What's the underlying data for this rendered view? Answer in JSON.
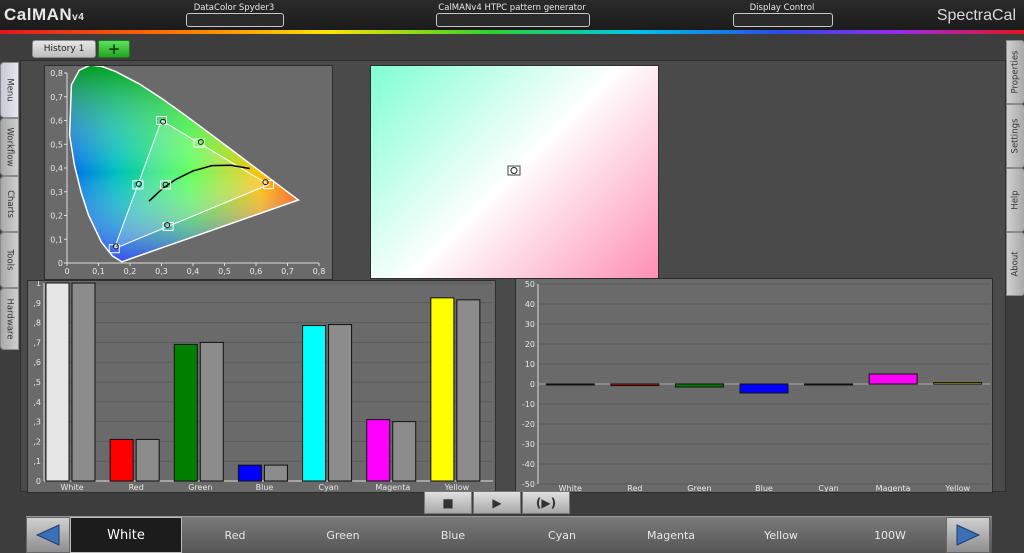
{
  "app": {
    "logo": "CalMAN",
    "logo_version": "v4",
    "brand": "SpectraCal"
  },
  "devices": {
    "meter": "DataColor Spyder3",
    "source": "CalMANv4 HTPC pattern generator",
    "display": "Display Control"
  },
  "left_tabs": [
    "Menu",
    "Workflow",
    "Charts",
    "Tools",
    "Hardware"
  ],
  "right_tabs": [
    "Properties",
    "Settings",
    "Help",
    "About"
  ],
  "history": {
    "tab_label": "History 1",
    "add_label": "+"
  },
  "patches": {
    "items": [
      "White",
      "Red",
      "Green",
      "Blue",
      "Cyan",
      "Magenta",
      "Yellow",
      "100W"
    ],
    "selected": "White"
  },
  "transport": {
    "stop": "■",
    "play": "▶",
    "play_all": "(▶)"
  },
  "colors": {
    "white": "#e6e6e6",
    "red": "#ff0000",
    "green": "#008000",
    "blue": "#0000ff",
    "cyan": "#00ffff",
    "magenta": "#ff00ff",
    "yellow": "#ffff00",
    "reference": "#8c8c8c"
  },
  "chart_data": [
    {
      "type": "scatter",
      "xlim": [
        0,
        0.8
      ],
      "ylim": [
        0,
        0.8
      ],
      "xticks": [
        "0",
        "0,1",
        "0,2",
        "0,3",
        "0,4",
        "0,5",
        "0,6",
        "0,7",
        "0,8"
      ],
      "yticks": [
        "0",
        "0,1",
        "0,2",
        "0,3",
        "0,4",
        "0,5",
        "0,6",
        "0,7",
        "0,8"
      ],
      "grid": false,
      "targets": [
        {
          "x": 0.64,
          "y": 0.33
        },
        {
          "x": 0.3,
          "y": 0.6
        },
        {
          "x": 0.15,
          "y": 0.06
        },
        {
          "x": 0.225,
          "y": 0.329
        },
        {
          "x": 0.321,
          "y": 0.154
        },
        {
          "x": 0.419,
          "y": 0.505
        },
        {
          "x": 0.3127,
          "y": 0.329
        }
      ],
      "measured": [
        {
          "x": 0.63,
          "y": 0.34
        },
        {
          "x": 0.305,
          "y": 0.595
        },
        {
          "x": 0.155,
          "y": 0.07
        },
        {
          "x": 0.228,
          "y": 0.333
        },
        {
          "x": 0.318,
          "y": 0.16
        },
        {
          "x": 0.425,
          "y": 0.51
        },
        {
          "x": 0.313,
          "y": 0.33
        }
      ]
    },
    {
      "type": "scatter",
      "measured": [
        {
          "x": 0.5,
          "y": 0.5
        }
      ]
    },
    {
      "type": "bar",
      "categories": [
        "White",
        "Red",
        "Green",
        "Blue",
        "Cyan",
        "Magenta",
        "Yellow"
      ],
      "ylim": [
        0,
        1
      ],
      "yticks": [
        "0",
        ",1",
        ",2",
        ",3",
        ",4",
        ",5",
        ",6",
        ",7",
        ",8",
        ",9",
        "1"
      ],
      "series": [
        {
          "values": [
            1.0,
            0.21,
            0.69,
            0.08,
            0.785,
            0.31,
            0.925
          ]
        },
        {
          "values": [
            1.0,
            0.21,
            0.7,
            0.08,
            0.79,
            0.3,
            0.915
          ]
        }
      ]
    },
    {
      "type": "bar",
      "categories": [
        "White",
        "Red",
        "Green",
        "Blue",
        "Cyan",
        "Magenta",
        "Yellow"
      ],
      "ylim": [
        -50,
        50
      ],
      "yticks": [
        "50",
        "40",
        "30",
        "20",
        "10",
        "0",
        "-10",
        "-20",
        "-30",
        "-40",
        "-50"
      ],
      "values": [
        0,
        -0.8,
        -1.5,
        -4.5,
        0,
        5,
        0.7
      ]
    }
  ]
}
